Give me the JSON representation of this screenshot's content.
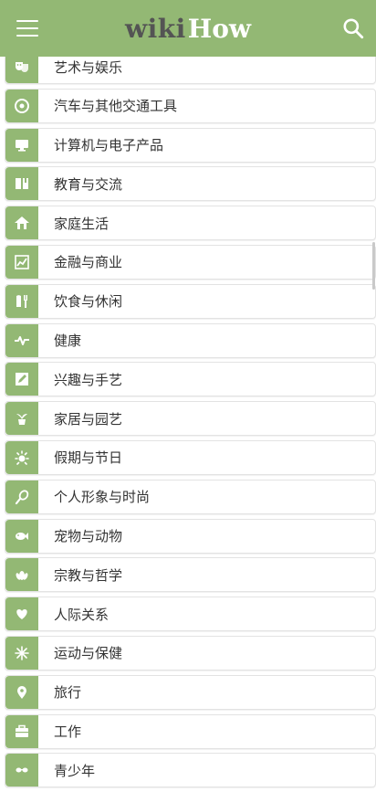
{
  "header": {
    "logo_wiki": "wiki",
    "logo_how": "How",
    "bg_color": "#93b874"
  },
  "categories": [
    {
      "label": "艺术与娱乐",
      "icon": "theater-masks-icon"
    },
    {
      "label": "汽车与其他交通工具",
      "icon": "steering-wheel-icon"
    },
    {
      "label": "计算机与电子产品",
      "icon": "monitor-icon"
    },
    {
      "label": "教育与交流",
      "icon": "book-icon"
    },
    {
      "label": "家庭生活",
      "icon": "house-icon"
    },
    {
      "label": "金融与商业",
      "icon": "line-chart-icon"
    },
    {
      "label": "饮食与休闲",
      "icon": "utensils-icon"
    },
    {
      "label": "健康",
      "icon": "heartbeat-icon"
    },
    {
      "label": "兴趣与手艺",
      "icon": "pencil-icon"
    },
    {
      "label": "家居与园艺",
      "icon": "potted-plant-icon"
    },
    {
      "label": "假期与节日",
      "icon": "sparkle-icon"
    },
    {
      "label": "个人形象与时尚",
      "icon": "mirror-icon"
    },
    {
      "label": "宠物与动物",
      "icon": "fish-icon"
    },
    {
      "label": "宗教与哲学",
      "icon": "lotus-icon"
    },
    {
      "label": "人际关系",
      "icon": "heart-icon"
    },
    {
      "label": "运动与保健",
      "icon": "asterisk-icon"
    },
    {
      "label": "旅行",
      "icon": "map-pin-icon"
    },
    {
      "label": "工作",
      "icon": "briefcase-icon"
    },
    {
      "label": "青少年",
      "icon": "sunglasses-icon"
    }
  ]
}
